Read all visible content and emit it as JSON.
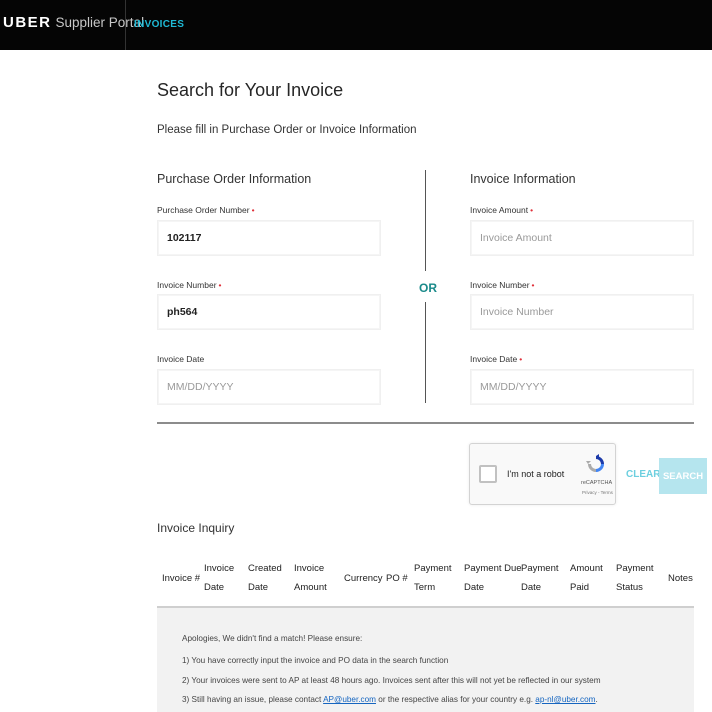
{
  "header": {
    "brand": "UBER",
    "product": "Supplier Portal",
    "nav_tab": "INVOICES"
  },
  "page": {
    "title": "Search for Your Invoice",
    "subtitle": "Please fill in Purchase Order or Invoice Information"
  },
  "po_section": {
    "title": "Purchase Order Information",
    "po_number": {
      "label": "Purchase Order Number",
      "value": "102117"
    },
    "invoice_number": {
      "label": "Invoice Number",
      "value": "ph564"
    },
    "invoice_date": {
      "label": "Invoice Date",
      "placeholder": "MM/DD/YYYY"
    }
  },
  "divider": {
    "or_text": "OR"
  },
  "invoice_section": {
    "title": "Invoice Information",
    "invoice_amount": {
      "label": "Invoice Amount",
      "placeholder": "Invoice Amount"
    },
    "invoice_number": {
      "label": "Invoice Number",
      "placeholder": "Invoice Number"
    },
    "invoice_date": {
      "label": "Invoice Date",
      "placeholder": "MM/DD/YYYY"
    }
  },
  "required_marker": "•",
  "captcha": {
    "label": "I'm not a robot",
    "brand": "reCAPTCHA",
    "links": "Privacy - Terms"
  },
  "actions": {
    "clear": "CLEAR",
    "search": "SEARCH"
  },
  "inquiry": {
    "title": "Invoice Inquiry",
    "columns": [
      [
        "Invoice #"
      ],
      [
        "Invoice",
        "Date"
      ],
      [
        "Created",
        "Date"
      ],
      [
        "Invoice",
        "Amount"
      ],
      [
        "Currency"
      ],
      [
        "PO #"
      ],
      [
        "Payment",
        "Term"
      ],
      [
        "Payment Due",
        "Date"
      ],
      [
        "Payment",
        "Date"
      ],
      [
        "Amount",
        "Paid"
      ],
      [
        "Payment",
        "Status"
      ],
      [
        "Notes"
      ]
    ],
    "no_match": {
      "intro": "Apologies, We didn't find a match! Please ensure:",
      "line1": "1) You have correctly input the invoice and PO data in the search function",
      "line2": "2) Your invoices were sent to AP at least 48 hours ago. Invoices sent after this will not yet be reflected in our system",
      "line3_prefix": "3) Still having an issue, please contact ",
      "line3_email1": "AP@uber.com",
      "line3_middle": " or the respective alias for your country e.g. ",
      "line3_email2": "ap-nl@uber.com",
      "line3_suffix": "."
    }
  },
  "colors": {
    "accent": "#1fbad6",
    "or_text": "#1a8a8a",
    "required": "#e0303a",
    "search_button": "#b5e5ee"
  }
}
